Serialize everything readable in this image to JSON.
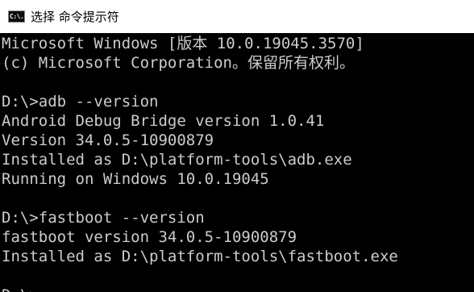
{
  "window": {
    "icon_label": "C:\\.",
    "title": "选择 命令提示符"
  },
  "console": {
    "lines": [
      "Microsoft Windows [版本 10.0.19045.3570]",
      "(c) Microsoft Corporation。保留所有权利。",
      "",
      "D:\\>adb --version",
      "Android Debug Bridge version 1.0.41",
      "Version 34.0.5-10900879",
      "Installed as D:\\platform-tools\\adb.exe",
      "Running on Windows 10.0.19045",
      "",
      "D:\\>fastboot --version",
      "fastboot version 34.0.5-10900879",
      "Installed as D:\\platform-tools\\fastboot.exe",
      "",
      "D:\\>"
    ]
  },
  "colors": {
    "console_background": "#000000",
    "console_text": "#cccccc",
    "titlebar_background": "#ffffff"
  }
}
